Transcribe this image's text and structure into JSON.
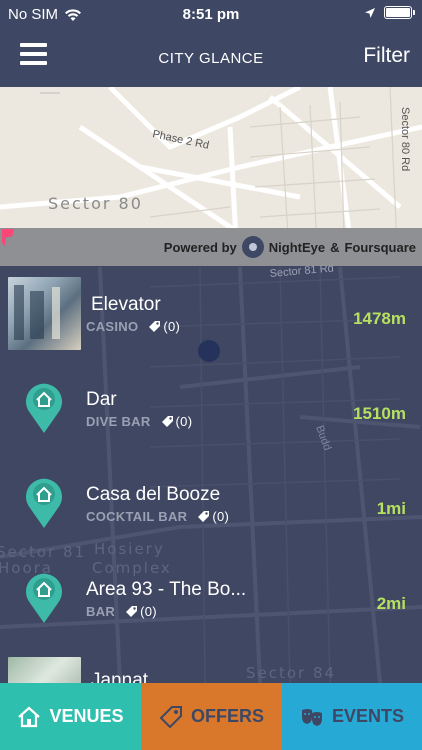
{
  "status_bar": {
    "carrier": "No SIM",
    "time": "8:51 pm"
  },
  "header": {
    "title": "CITY GLANCE",
    "filter_label": "Filter",
    "menu_icon": "hamburger-menu-icon"
  },
  "map": {
    "labels": {
      "road_phase2": "Phase 2 Rd",
      "sector80": "Sector 80",
      "sector80_road": "Sector 80 Rd",
      "sector81_rd": "Sector 81 Rd",
      "sector81": "Sector 81",
      "hosiery": "Hosiery",
      "complex": "Complex",
      "hoora": "Hoora",
      "sector84": "Sector 84",
      "budd": "Budd"
    },
    "powered_by": {
      "prefix": "Powered by",
      "nighteye": "NightEye",
      "amp": "&",
      "foursquare": "Foursquare"
    }
  },
  "venues": [
    {
      "name": "Elevator",
      "category": "CASINO",
      "tag_count": "(0)",
      "distance": "1478m",
      "media": "photo"
    },
    {
      "name": "Dar",
      "category": "DIVE BAR",
      "tag_count": "(0)",
      "distance": "1510m",
      "media": "pin"
    },
    {
      "name": "Casa del Booze",
      "category": "COCKTAIL BAR",
      "tag_count": "(0)",
      "distance": "1mi",
      "media": "pin"
    },
    {
      "name": "Area 93 - The Bo...",
      "category": "BAR",
      "tag_count": "(0)",
      "distance": "2mi",
      "media": "pin"
    },
    {
      "name": "Jannat",
      "category": "",
      "tag_count": "",
      "distance": "",
      "media": "photo"
    }
  ],
  "tabs": {
    "venues": "VENUES",
    "offers": "OFFERS",
    "events": "EVENTS"
  },
  "colors": {
    "header": "#3e4865",
    "map_dark": "#3f4762",
    "distance": "#b6e060",
    "pin": "#3dbba8",
    "tab_venues": "#2fbfae",
    "tab_offers": "#d9782a",
    "tab_events": "#27a9d6"
  }
}
